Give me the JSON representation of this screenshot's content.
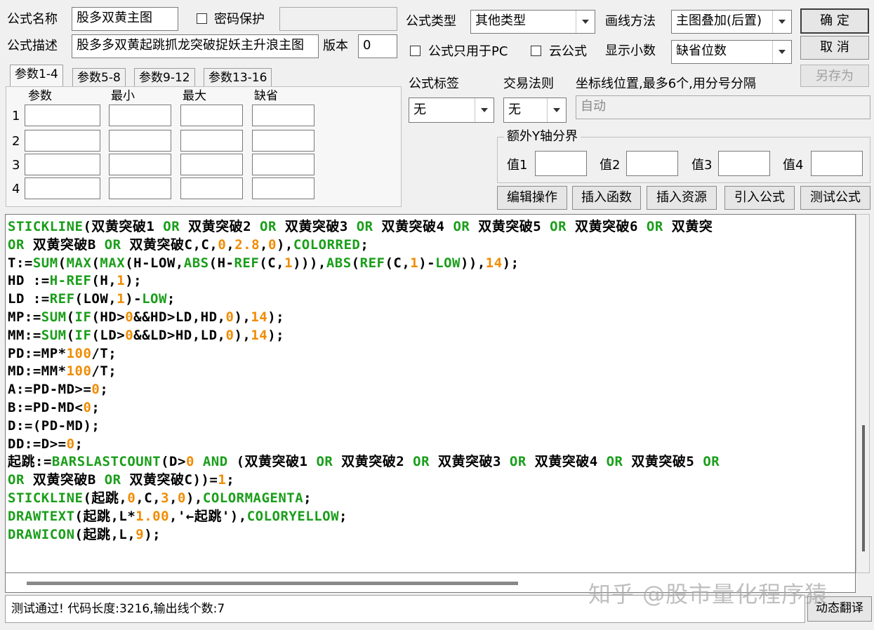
{
  "labels": {
    "formula_name": "公式名称",
    "password_protect": "密码保护",
    "formula_desc": "公式描述",
    "version": "版本",
    "formula_type": "公式类型",
    "draw_method": "画线方法",
    "pc_only": "公式只用于PC",
    "cloud_formula": "云公式",
    "show_decimals": "显示小数",
    "formula_tag": "公式标签",
    "trade_rule": "交易法则",
    "axis_position": "坐标线位置,最多6个,用分号分隔",
    "extra_y_axis": "额外Y轴分界",
    "val1": "值1",
    "val2": "值2",
    "val3": "值3",
    "val4": "值4"
  },
  "fields": {
    "formula_name": "股多双黄主图",
    "formula_desc": "股多多双黄起跳抓龙突破捉妖主升浪主图",
    "version": "0",
    "formula_type": "其他类型",
    "draw_method": "主图叠加(后置)",
    "show_decimals": "缺省位数",
    "formula_tag": "无",
    "trade_rule": "无",
    "axis_position": "自动"
  },
  "buttons": {
    "ok": "确  定",
    "cancel": "取  消",
    "save_as": "另存为",
    "edit_ops": "编辑操作",
    "insert_func": "插入函数",
    "insert_res": "插入资源",
    "import_formula": "引入公式",
    "test_formula": "测试公式",
    "dynamic_translate": "动态翻译"
  },
  "tabs": [
    "参数1-4",
    "参数5-8",
    "参数9-12",
    "参数13-16"
  ],
  "param_headers": [
    "参数",
    "最小",
    "最大",
    "缺省"
  ],
  "param_rows": [
    "1",
    "2",
    "3",
    "4"
  ],
  "code_lines": [
    [
      [
        "kw",
        "STICKLINE"
      ],
      [
        "op",
        "(双黄突破1 "
      ],
      [
        "kw",
        "OR"
      ],
      [
        "op",
        " 双黄突破2 "
      ],
      [
        "kw",
        "OR"
      ],
      [
        "op",
        " 双黄突破3 "
      ],
      [
        "kw",
        "OR"
      ],
      [
        "op",
        " 双黄突破4 "
      ],
      [
        "kw",
        "OR"
      ],
      [
        "op",
        " 双黄突破5 "
      ],
      [
        "kw",
        "OR"
      ],
      [
        "op",
        " 双黄突破6 "
      ],
      [
        "kw",
        "OR"
      ],
      [
        "op",
        " 双黄突"
      ]
    ],
    [
      [
        "kw",
        "OR"
      ],
      [
        "op",
        " 双黄突破B "
      ],
      [
        "kw",
        "OR"
      ],
      [
        "op",
        " 双黄突破C,C,"
      ],
      [
        "num",
        "0"
      ],
      [
        "op",
        ","
      ],
      [
        "num",
        "2.8"
      ],
      [
        "op",
        ","
      ],
      [
        "num",
        "0"
      ],
      [
        "op",
        "),"
      ],
      [
        "kw",
        "COLORRED"
      ],
      [
        "op",
        ";"
      ]
    ],
    [
      [
        "op",
        "T:="
      ],
      [
        "kw",
        "SUM"
      ],
      [
        "op",
        "("
      ],
      [
        "kw",
        "MAX"
      ],
      [
        "op",
        "("
      ],
      [
        "kw",
        "MAX"
      ],
      [
        "op",
        "(H-LOW,"
      ],
      [
        "kw",
        "ABS"
      ],
      [
        "op",
        "(H-"
      ],
      [
        "kw",
        "REF"
      ],
      [
        "op",
        "(C,"
      ],
      [
        "num",
        "1"
      ],
      [
        "op",
        ")))"
      ],
      [
        "op",
        ","
      ],
      [
        "kw",
        "ABS"
      ],
      [
        "op",
        "("
      ],
      [
        "kw",
        "REF"
      ],
      [
        "op",
        "(C,"
      ],
      [
        "num",
        "1"
      ],
      [
        "op",
        ")-"
      ],
      [
        "kw",
        "LOW"
      ],
      [
        "op",
        ")),"
      ],
      [
        "num",
        "14"
      ],
      [
        "op",
        ");"
      ]
    ],
    [
      [
        "op",
        "HD :="
      ],
      [
        "kw",
        "H-REF"
      ],
      [
        "op",
        "(H,"
      ],
      [
        "num",
        "1"
      ],
      [
        "op",
        ");"
      ]
    ],
    [
      [
        "op",
        "LD :="
      ],
      [
        "kw",
        "REF"
      ],
      [
        "op",
        "(LOW,"
      ],
      [
        "num",
        "1"
      ],
      [
        "op",
        ")-"
      ],
      [
        "kw",
        "LOW"
      ],
      [
        "op",
        ";"
      ]
    ],
    [
      [
        "op",
        "MP:="
      ],
      [
        "kw",
        "SUM"
      ],
      [
        "op",
        "("
      ],
      [
        "kw",
        "IF"
      ],
      [
        "op",
        "(HD>"
      ],
      [
        "num",
        "0"
      ],
      [
        "op",
        "&&HD>LD,HD,"
      ],
      [
        "num",
        "0"
      ],
      [
        "op",
        "),"
      ],
      [
        "num",
        "14"
      ],
      [
        "op",
        ");"
      ]
    ],
    [
      [
        "op",
        "MM:="
      ],
      [
        "kw",
        "SUM"
      ],
      [
        "op",
        "("
      ],
      [
        "kw",
        "IF"
      ],
      [
        "op",
        "(LD>"
      ],
      [
        "num",
        "0"
      ],
      [
        "op",
        "&&LD>HD,LD,"
      ],
      [
        "num",
        "0"
      ],
      [
        "op",
        "),"
      ],
      [
        "num",
        "14"
      ],
      [
        "op",
        ");"
      ]
    ],
    [
      [
        "op",
        "PD:=MP*"
      ],
      [
        "num",
        "100"
      ],
      [
        "op",
        "/T;"
      ]
    ],
    [
      [
        "op",
        "MD:=MM*"
      ],
      [
        "num",
        "100"
      ],
      [
        "op",
        "/T;"
      ]
    ],
    [
      [
        "op",
        "A:=PD-MD>="
      ],
      [
        "num",
        "0"
      ],
      [
        "op",
        ";"
      ]
    ],
    [
      [
        "op",
        "B:=PD-MD<"
      ],
      [
        "num",
        "0"
      ],
      [
        "op",
        ";"
      ]
    ],
    [
      [
        "op",
        "D:=(PD-MD);"
      ]
    ],
    [
      [
        "op",
        "DD:=D>="
      ],
      [
        "num",
        "0"
      ],
      [
        "op",
        ";"
      ]
    ],
    [
      [
        "op",
        "起跳:="
      ],
      [
        "kw",
        "BARSLASTCOUNT"
      ],
      [
        "op",
        "(D>"
      ],
      [
        "num",
        "0"
      ],
      [
        "op",
        " "
      ],
      [
        "kw",
        "AND"
      ],
      [
        "op",
        " (双黄突破1 "
      ],
      [
        "kw",
        "OR"
      ],
      [
        "op",
        " 双黄突破2 "
      ],
      [
        "kw",
        "OR"
      ],
      [
        "op",
        " 双黄突破3 "
      ],
      [
        "kw",
        "OR"
      ],
      [
        "op",
        " 双黄突破4 "
      ],
      [
        "kw",
        "OR"
      ],
      [
        "op",
        " 双黄突破5 "
      ],
      [
        "kw",
        "OR"
      ]
    ],
    [
      [
        "kw",
        "OR"
      ],
      [
        "op",
        " 双黄突破B "
      ],
      [
        "kw",
        "OR"
      ],
      [
        "op",
        " 双黄突破C))="
      ],
      [
        "num",
        "1"
      ],
      [
        "op",
        ";"
      ]
    ],
    [
      [
        "kw",
        "STICKLINE"
      ],
      [
        "op",
        "(起跳,"
      ],
      [
        "num",
        "0"
      ],
      [
        "op",
        ",C,"
      ],
      [
        "num",
        "3"
      ],
      [
        "op",
        ","
      ],
      [
        "num",
        "0"
      ],
      [
        "op",
        "),"
      ],
      [
        "kw",
        "COLORMAGENTA"
      ],
      [
        "op",
        ";"
      ]
    ],
    [
      [
        "kw",
        "DRAWTEXT"
      ],
      [
        "op",
        "(起跳,L*"
      ],
      [
        "num",
        "1.00"
      ],
      [
        "op",
        ",'←起跳'),"
      ],
      [
        "kw",
        "COLORYELLOW"
      ],
      [
        "op",
        ";"
      ]
    ],
    [
      [
        "kw",
        "DRAWICON"
      ],
      [
        "op",
        "(起跳,L,"
      ],
      [
        "num",
        "9"
      ],
      [
        "op",
        ");"
      ]
    ]
  ],
  "status_text": "测试通过! 代码长度:3216,输出线个数:7",
  "watermark": "知乎 @股市量化程序猿"
}
